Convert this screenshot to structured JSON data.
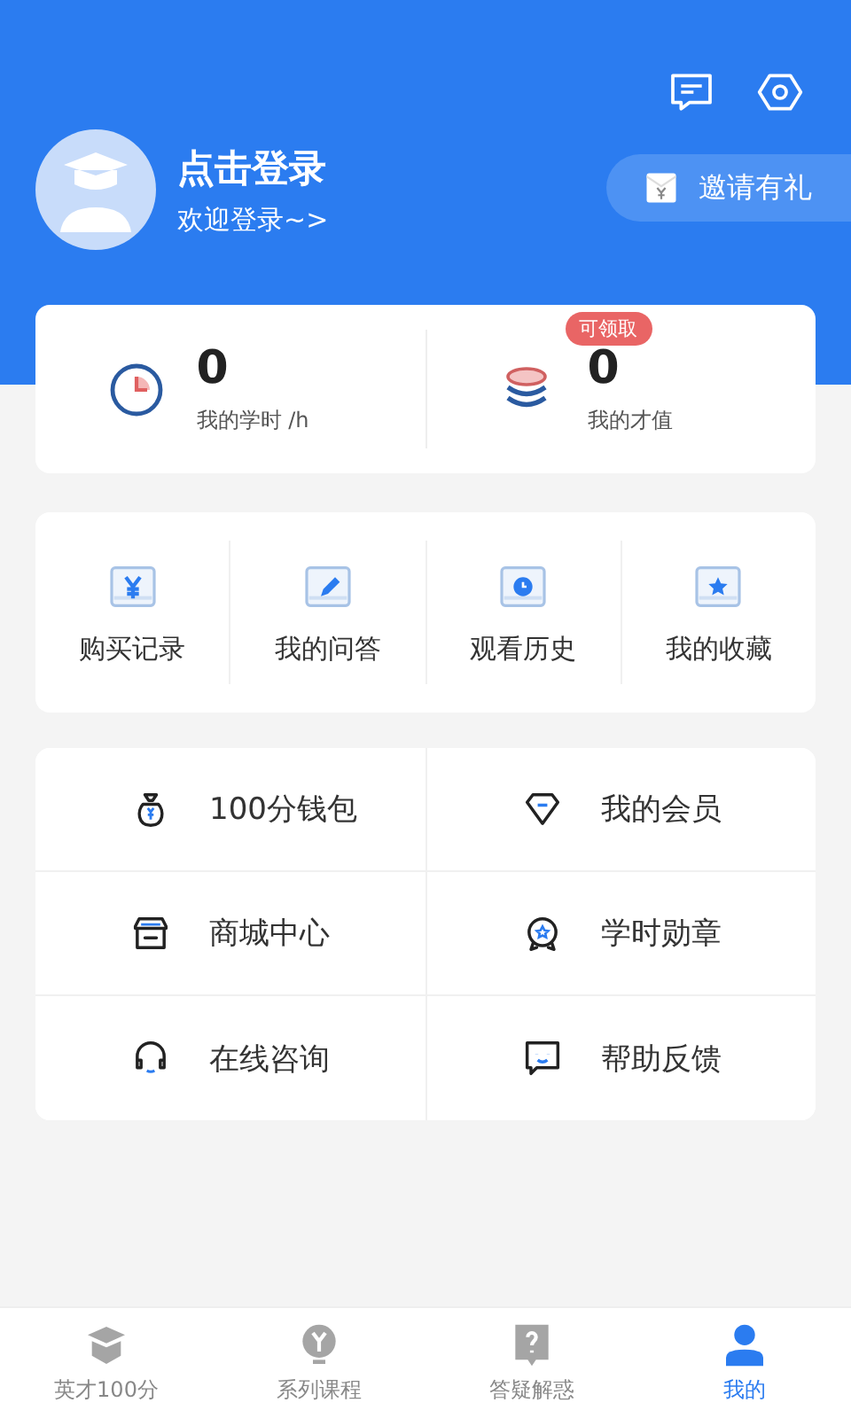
{
  "profile": {
    "title": "点击登录",
    "subtitle": "欢迎登录~>"
  },
  "invite": {
    "label": "邀请有礼"
  },
  "stats": [
    {
      "value": "0",
      "label": "我的学时 /h"
    },
    {
      "value": "0",
      "label": "我的才值",
      "badge": "可领取"
    }
  ],
  "shortcuts": [
    "购买记录",
    "我的问答",
    "观看历史",
    "我的收藏"
  ],
  "services": [
    "100分钱包",
    "我的会员",
    "商城中心",
    "学时勋章",
    "在线咨询",
    "帮助反馈"
  ],
  "tabs": [
    {
      "label": "英才100分",
      "selected": false
    },
    {
      "label": "系列课程",
      "selected": false
    },
    {
      "label": "答疑解惑",
      "selected": false
    },
    {
      "label": "我的",
      "selected": true
    }
  ]
}
